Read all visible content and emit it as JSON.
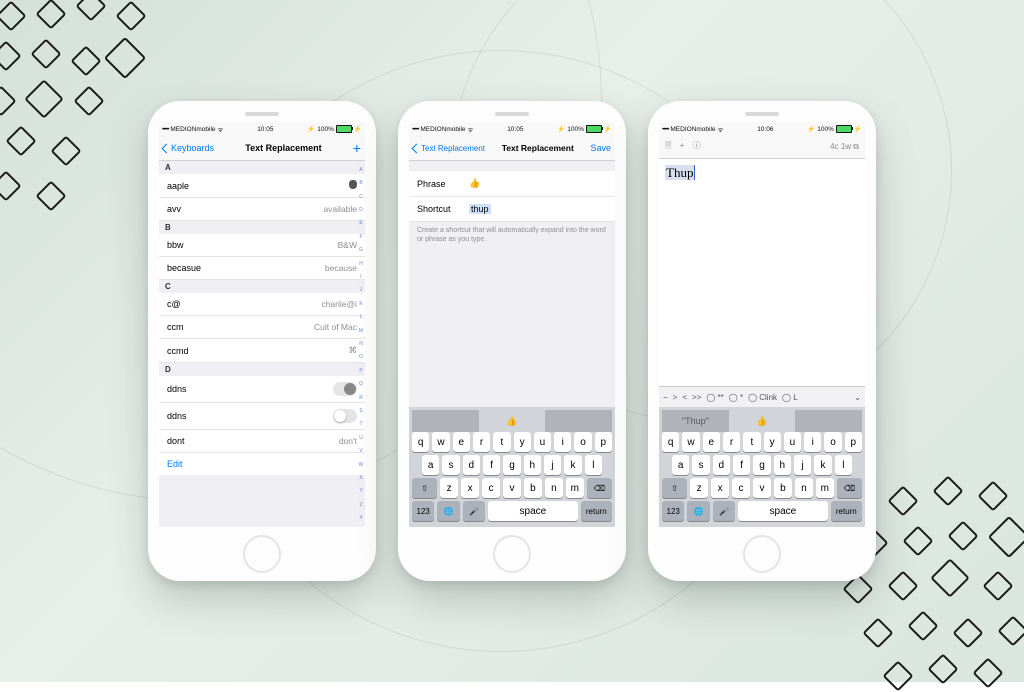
{
  "status": {
    "carrier": "MEDIONmobile",
    "time1": "10:05",
    "time3": "10:06",
    "battery": "100%"
  },
  "phone1": {
    "back": "Keyboards",
    "title": "Text Replacement",
    "edit": "Edit",
    "sections": {
      "A": [
        {
          "k": "aaple",
          "v": "",
          "icon": "apple"
        },
        {
          "k": "avv",
          "v": "available"
        }
      ],
      "B": [
        {
          "k": "bbw",
          "v": "B&W"
        },
        {
          "k": "becasue",
          "v": "because"
        }
      ],
      "C": [
        {
          "k": "c@",
          "v": "charlie@i"
        },
        {
          "k": "ccm",
          "v": "Cult of Mac"
        },
        {
          "k": "ccmd",
          "v": "⌘"
        }
      ],
      "D": [
        {
          "k": "ddns",
          "v": "",
          "toggle": "on"
        },
        {
          "k": "ddns",
          "v": "",
          "toggle": "off"
        },
        {
          "k": "dont",
          "v": "don't"
        }
      ]
    },
    "index": [
      "A",
      "B",
      "C",
      "D",
      "E",
      "F",
      "G",
      "H",
      "I",
      "J",
      "K",
      "L",
      "M",
      "N",
      "O",
      "P",
      "Q",
      "R",
      "S",
      "T",
      "U",
      "V",
      "W",
      "X",
      "Y",
      "Z",
      "#"
    ]
  },
  "phone2": {
    "back": "Text Replacement",
    "title": "Text Replacement",
    "action": "Save",
    "phrase_label": "Phrase",
    "phrase_value": "👍",
    "shortcut_label": "Shortcut",
    "shortcut_value": "thup",
    "hint": "Create a shortcut that will automatically expand into the word or phrase as you type.",
    "suggestion_emoji": "👍"
  },
  "phone3": {
    "counter": "4c 1w",
    "text": "Thup",
    "toolbar": [
      "−",
      ">",
      "<",
      ">>",
      "◯ **",
      "◯ *",
      "◯ Clink",
      "◯ L"
    ],
    "sugg_quoted": "\"Thup\"",
    "sugg_emoji": "👍"
  },
  "keyboard": {
    "rows": [
      [
        "q",
        "w",
        "e",
        "r",
        "t",
        "y",
        "u",
        "i",
        "o",
        "p"
      ],
      [
        "a",
        "s",
        "d",
        "f",
        "g",
        "h",
        "j",
        "k",
        "l"
      ],
      [
        "z",
        "x",
        "c",
        "v",
        "b",
        "n",
        "m"
      ]
    ],
    "shift": "⇧",
    "bksp": "⌫",
    "num": "123",
    "globe": "🌐",
    "mic": "🎤",
    "space": "space",
    "ret": "return"
  }
}
